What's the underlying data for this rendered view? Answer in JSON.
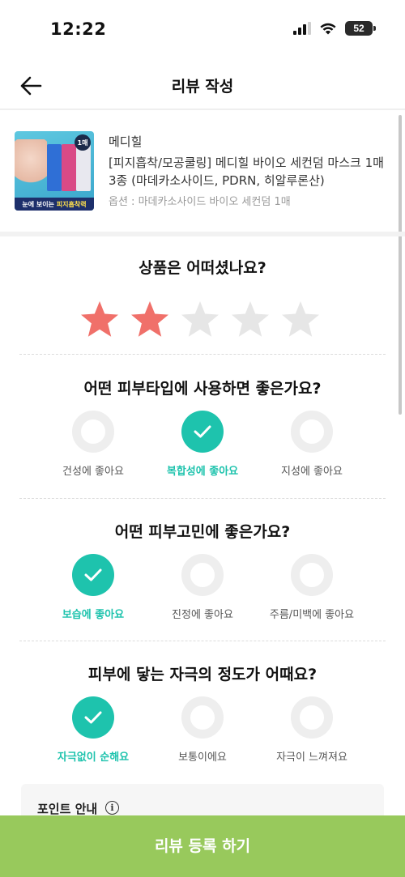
{
  "status_bar": {
    "time": "12:22",
    "battery": "52"
  },
  "header": {
    "title": "리뷰 작성"
  },
  "product": {
    "brand": "메디힐",
    "name": "[피지흡착/모공쿨링] 메디힐 바이오 세컨덤 마스크 1매 3종 (마데카소사이드, PDRN, 히알루론산)",
    "option": "옵션 : 마데카소사이드 바이오 세컨덤 1매",
    "thumb_badge": "1매",
    "thumb_banner": "눈에 보이는",
    "thumb_banner_highlight": "피지흡착력"
  },
  "rating": {
    "question": "상품은 어떠셨나요?",
    "value": 2,
    "max": 5,
    "filled_color": "#f0706a",
    "empty_color": "#e6e6e6"
  },
  "skin_type": {
    "question": "어떤 피부타입에 사용하면 좋은가요?",
    "options": [
      {
        "label": "건성에 좋아요",
        "selected": false
      },
      {
        "label": "복합성에 좋아요",
        "selected": true
      },
      {
        "label": "지성에 좋아요",
        "selected": false
      }
    ]
  },
  "skin_concern": {
    "question": "어떤 피부고민에 좋은가요?",
    "options": [
      {
        "label": "보습에 좋아요",
        "selected": true
      },
      {
        "label": "진정에 좋아요",
        "selected": false
      },
      {
        "label": "주름/미백에 좋아요",
        "selected": false
      }
    ]
  },
  "irritation": {
    "question": "피부에 닿는 자극의 정도가 어때요?",
    "options": [
      {
        "label": "자극없이 순해요",
        "selected": true
      },
      {
        "label": "보통이에요",
        "selected": false
      },
      {
        "label": "자극이 느껴져요",
        "selected": false
      }
    ]
  },
  "point_info": {
    "title": "포인트 안내"
  },
  "submit": {
    "label": "리뷰 등록 하기"
  },
  "colors": {
    "accent": "#1ec3ad",
    "submit_bg": "#98c95c"
  }
}
